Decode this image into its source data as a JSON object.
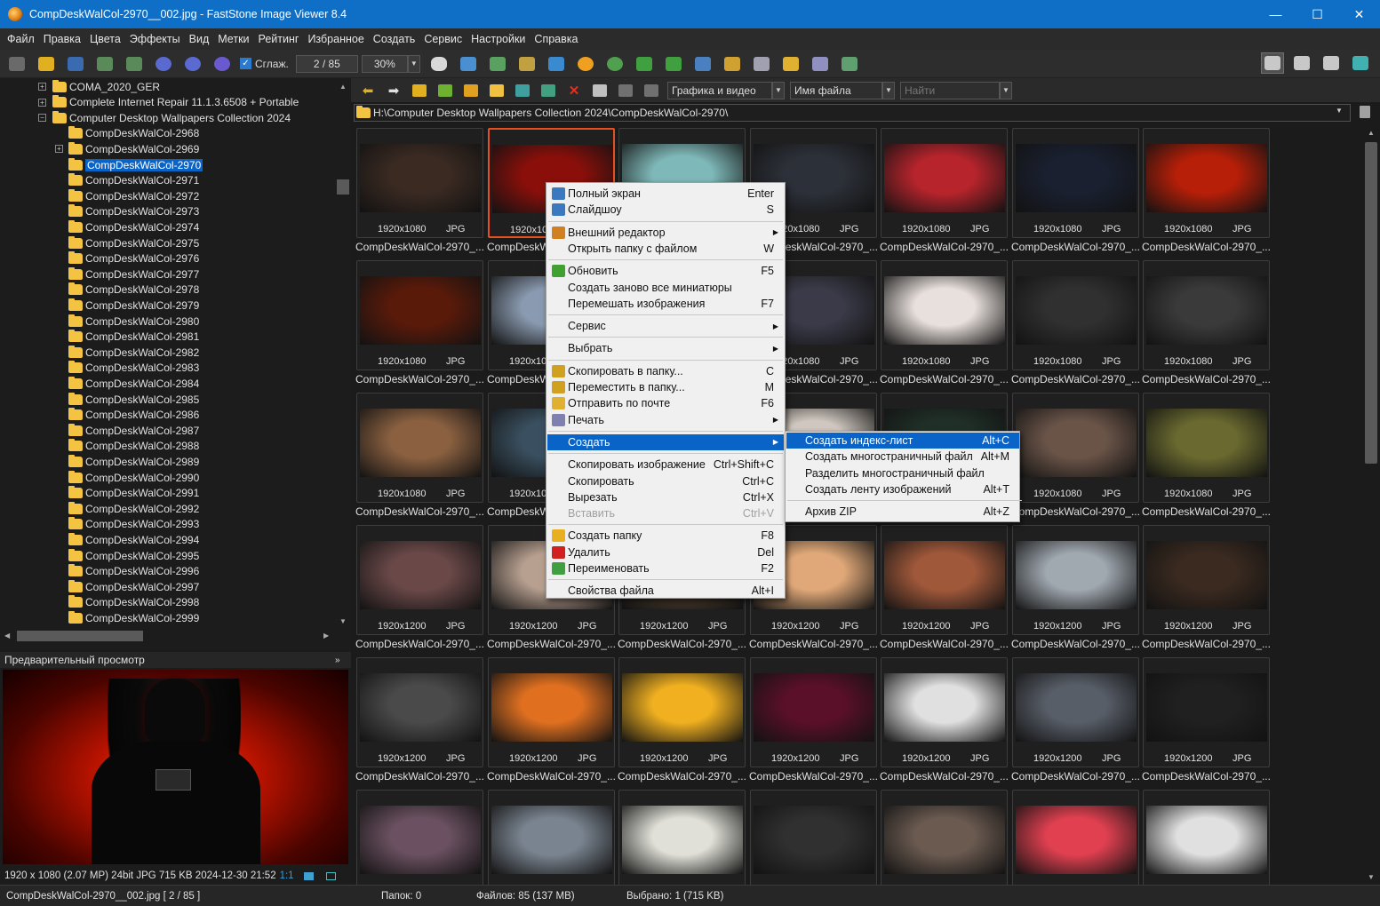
{
  "window": {
    "title": "CompDeskWalCol-2970__002.jpg - FastStone Image Viewer 8.4",
    "minimize": "—",
    "maximize": "☐",
    "close": "✕"
  },
  "menu": [
    "Файл",
    "Правка",
    "Цвета",
    "Эффекты",
    "Вид",
    "Метки",
    "Рейтинг",
    "Избранное",
    "Создать",
    "Сервис",
    "Настройки",
    "Справка"
  ],
  "toolbar": {
    "smooth_label": "Сглаж.",
    "page": "2 / 85",
    "zoom": "30%"
  },
  "nav": {
    "filter": "Графика и видео",
    "sort": "Имя файла",
    "search_placeholder": "Найти"
  },
  "path": "H:\\Computer Desktop Wallpapers Collection 2024\\CompDeskWalCol-2970\\",
  "tree": [
    {
      "label": "COMA_2020_GER",
      "level": 1,
      "expander": "+"
    },
    {
      "label": "Complete Internet Repair 11.1.3.6508 + Portable",
      "level": 1,
      "expander": "+"
    },
    {
      "label": "Computer Desktop Wallpapers Collection 2024",
      "level": 1,
      "expander": "−"
    },
    {
      "label": "CompDeskWalCol-2968",
      "level": 2
    },
    {
      "label": "CompDeskWalCol-2969",
      "level": 2,
      "expander": "+"
    },
    {
      "label": "CompDeskWalCol-2970",
      "level": 2,
      "selected": true
    },
    {
      "label": "CompDeskWalCol-2971",
      "level": 2
    },
    {
      "label": "CompDeskWalCol-2972",
      "level": 2
    },
    {
      "label": "CompDeskWalCol-2973",
      "level": 2
    },
    {
      "label": "CompDeskWalCol-2974",
      "level": 2
    },
    {
      "label": "CompDeskWalCol-2975",
      "level": 2
    },
    {
      "label": "CompDeskWalCol-2976",
      "level": 2
    },
    {
      "label": "CompDeskWalCol-2977",
      "level": 2
    },
    {
      "label": "CompDeskWalCol-2978",
      "level": 2
    },
    {
      "label": "CompDeskWalCol-2979",
      "level": 2
    },
    {
      "label": "CompDeskWalCol-2980",
      "level": 2
    },
    {
      "label": "CompDeskWalCol-2981",
      "level": 2
    },
    {
      "label": "CompDeskWalCol-2982",
      "level": 2
    },
    {
      "label": "CompDeskWalCol-2983",
      "level": 2
    },
    {
      "label": "CompDeskWalCol-2984",
      "level": 2
    },
    {
      "label": "CompDeskWalCol-2985",
      "level": 2
    },
    {
      "label": "CompDeskWalCol-2986",
      "level": 2
    },
    {
      "label": "CompDeskWalCol-2987",
      "level": 2
    },
    {
      "label": "CompDeskWalCol-2988",
      "level": 2
    },
    {
      "label": "CompDeskWalCol-2989",
      "level": 2
    },
    {
      "label": "CompDeskWalCol-2990",
      "level": 2
    },
    {
      "label": "CompDeskWalCol-2991",
      "level": 2
    },
    {
      "label": "CompDeskWalCol-2992",
      "level": 2
    },
    {
      "label": "CompDeskWalCol-2993",
      "level": 2
    },
    {
      "label": "CompDeskWalCol-2994",
      "level": 2
    },
    {
      "label": "CompDeskWalCol-2995",
      "level": 2
    },
    {
      "label": "CompDeskWalCol-2996",
      "level": 2
    },
    {
      "label": "CompDeskWalCol-2997",
      "level": 2
    },
    {
      "label": "CompDeskWalCol-2998",
      "level": 2
    },
    {
      "label": "CompDeskWalCol-2999",
      "level": 2
    }
  ],
  "preview": {
    "header": "Предварительный просмотр",
    "info": "1920 x 1080 (2.07 MP)  24bit  JPG   715 KB   2024-12-30 21:52",
    "ratio": "1:1"
  },
  "status": {
    "file": "CompDeskWalCol-2970__002.jpg [ 2 / 85 ]",
    "folders": "Папок: 0",
    "files": "Файлов: 85 (137 MB)",
    "selected": "Выбрано: 1 (715 KB)"
  },
  "thumbs": {
    "ext": "JPG",
    "name": "CompDeskWalCol-2970_...",
    "rows": [
      {
        "res": "1920x1080",
        "bgs": [
          "#3a2a22",
          "#8a0f0a",
          "#7fb8b8",
          "#2c3038",
          "#b8242c",
          "#1a2030",
          "#b81f08"
        ]
      },
      {
        "res": "1920x1080",
        "bgs": [
          "#5a1a0a",
          "#8a9ab0",
          "#402050",
          "#3a3a48",
          "#e8e0dc",
          "#303030",
          "#3a3a3a"
        ]
      },
      {
        "res": "1920x1080",
        "bgs": [
          "#8a6040",
          "#3a5060",
          "#302820",
          "#d0c8c0",
          "#203028",
          "#6a5448",
          "#6a6a30"
        ]
      },
      {
        "res": "1920x1200",
        "bgs": [
          "#6a4848",
          "#b8a090",
          "#504030",
          "#e0a878",
          "#a0583a",
          "#a0a8b0",
          "#3a2a20"
        ]
      },
      {
        "res": "1920x1200",
        "bgs": [
          "#4a4a4a",
          "#e07020",
          "#f0b020",
          "#5a1028",
          "#e0e0e0",
          "#585e68",
          "#202020"
        ]
      },
      {
        "res": "",
        "bgs": [
          "#6a5060",
          "#7a8490",
          "#e0e0d8",
          "#303030",
          "#6a5a50",
          "#e04050",
          "#e0e0e0"
        ]
      }
    ]
  },
  "context_menu": [
    {
      "label": "Полный экран",
      "shortcut": "Enter",
      "icon": "fullscreen-icon"
    },
    {
      "label": "Слайдшоу",
      "shortcut": "S",
      "icon": "slideshow-icon"
    },
    {
      "sep": true
    },
    {
      "label": "Внешний редактор",
      "arrow": true,
      "icon": "external-editor-icon"
    },
    {
      "label": "Открыть папку с файлом",
      "shortcut": "W"
    },
    {
      "sep": true
    },
    {
      "label": "Обновить",
      "shortcut": "F5",
      "icon": "refresh-icon"
    },
    {
      "label": "Создать заново все миниатюры",
      "shortcut": ""
    },
    {
      "label": "Перемешать изображения",
      "shortcut": "F7"
    },
    {
      "sep": true
    },
    {
      "label": "Сервис",
      "arrow": true
    },
    {
      "sep": true
    },
    {
      "label": "Выбрать",
      "arrow": true
    },
    {
      "sep": true
    },
    {
      "label": "Скопировать в папку...",
      "shortcut": "C",
      "icon": "copy-to-folder-icon"
    },
    {
      "label": "Переместить в папку...",
      "shortcut": "M",
      "icon": "move-to-folder-icon"
    },
    {
      "label": "Отправить по почте",
      "shortcut": "F6",
      "icon": "email-icon"
    },
    {
      "label": "Печать",
      "arrow": true,
      "icon": "print-icon"
    },
    {
      "sep": true
    },
    {
      "label": "Создать",
      "arrow": true,
      "highlight": true
    },
    {
      "sep": true
    },
    {
      "label": "Скопировать изображение",
      "shortcut": "Ctrl+Shift+C"
    },
    {
      "label": "Скопировать",
      "shortcut": "Ctrl+C"
    },
    {
      "label": "Вырезать",
      "shortcut": "Ctrl+X"
    },
    {
      "label": "Вставить",
      "shortcut": "Ctrl+V",
      "disabled": true
    },
    {
      "sep": true
    },
    {
      "label": "Создать папку",
      "shortcut": "F8",
      "icon": "new-folder-icon"
    },
    {
      "label": "Удалить",
      "shortcut": "Del",
      "icon": "delete-icon"
    },
    {
      "label": "Переименовать",
      "shortcut": "F2",
      "icon": "rename-icon"
    },
    {
      "sep": true
    },
    {
      "label": "Свойства файла",
      "shortcut": "Alt+I"
    }
  ],
  "submenu": [
    {
      "label": "Создать индекс-лист",
      "shortcut": "Alt+C",
      "highlight": true
    },
    {
      "label": "Создать многостраничный файл",
      "shortcut": "Alt+M"
    },
    {
      "label": "Разделить многостраничный файл",
      "shortcut": ""
    },
    {
      "label": "Создать ленту изображений",
      "shortcut": "Alt+T"
    },
    {
      "sep": true
    },
    {
      "label": "Архив ZIP",
      "shortcut": "Alt+Z"
    }
  ],
  "colors": {
    "accent": "#0a64c8",
    "title_bar": "#0f6fc6",
    "selection_border": "#e55022"
  }
}
